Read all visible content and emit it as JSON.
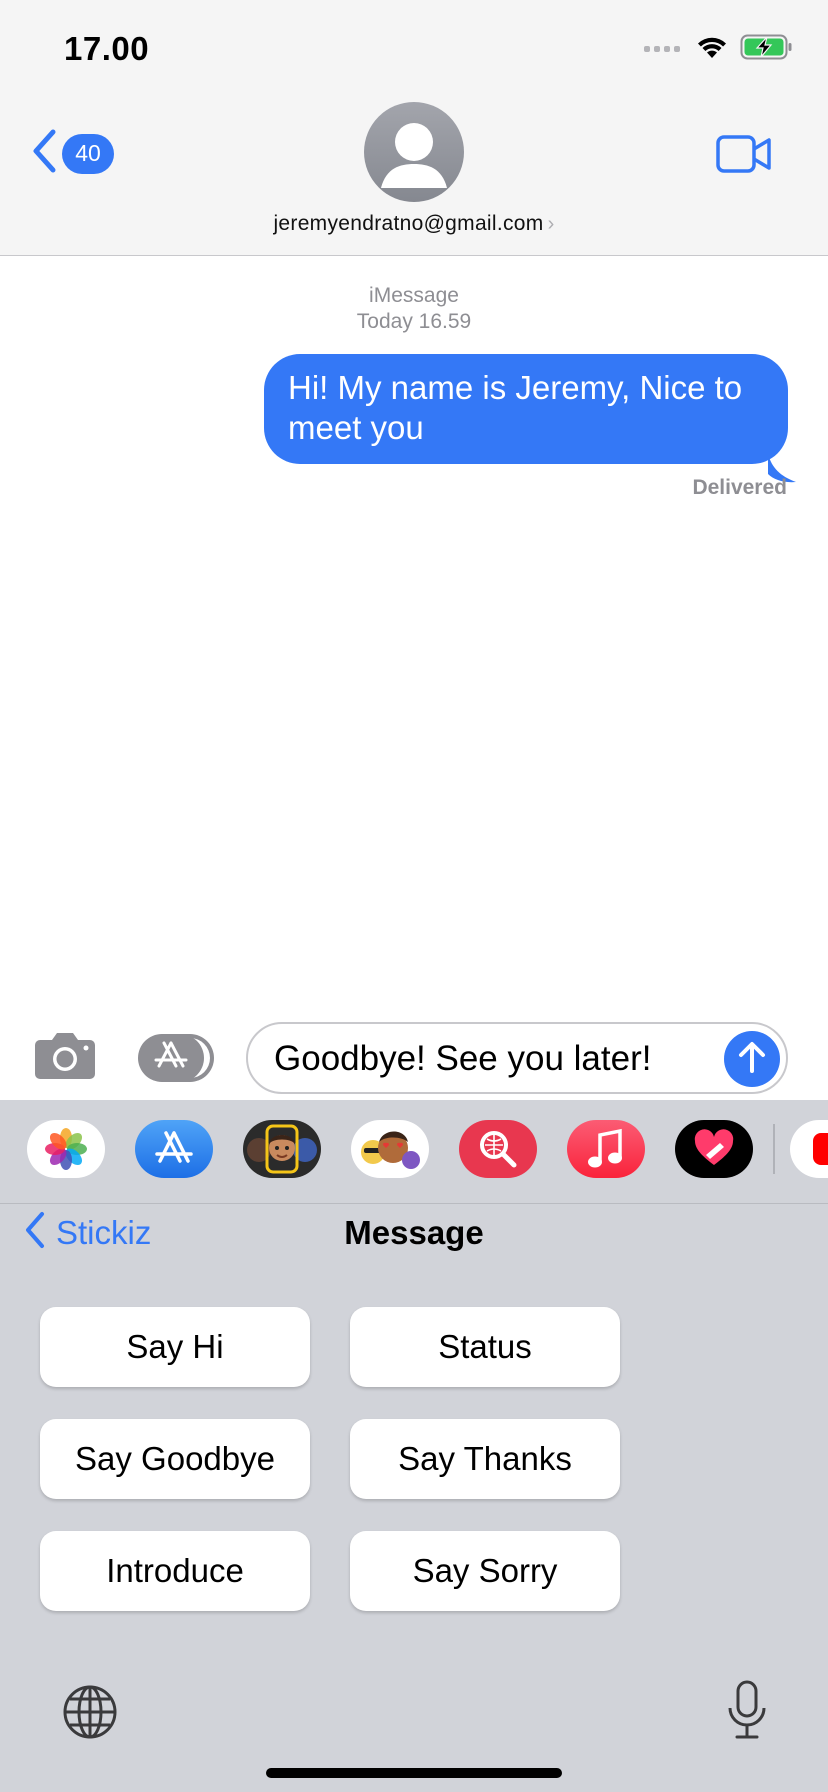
{
  "status_bar": {
    "time": "17.00",
    "icons": [
      "signal-icon",
      "wifi-icon",
      "battery-charging-icon"
    ]
  },
  "header": {
    "back_count": "40",
    "contact": "jeremyendratno@gmail.com",
    "contact_chevron": "›",
    "icons": [
      "chevron-left-icon",
      "avatar-icon",
      "video-camera-icon"
    ]
  },
  "conversation": {
    "service": "iMessage",
    "timestamp": "Today 16.59",
    "messages": [
      {
        "text": "Hi! My name is Jeremy, Nice to meet you",
        "sender": "me"
      }
    ],
    "delivered": "Delivered"
  },
  "composer": {
    "text": "Goodbye! See you later!",
    "icons": [
      "camera-icon",
      "app-store-icon",
      "send-arrow-icon"
    ]
  },
  "app_strip": {
    "apps": [
      "photos-icon",
      "app-store-icon",
      "memoji-camera-icon",
      "memoji-stickers-icon",
      "web-search-icon",
      "music-icon",
      "digital-touch-icon",
      "video-app-icon"
    ]
  },
  "extension": {
    "back_label": "Stickiz",
    "title": "Message",
    "buttons": [
      "Say Hi",
      "Status",
      "Say Goodbye",
      "Say Thanks",
      "Introduce",
      "Say Sorry"
    ]
  },
  "keyboard": {
    "icons": [
      "globe-icon",
      "microphone-icon"
    ]
  },
  "colors": {
    "accent": "#3478f6",
    "drawer_bg": "#d1d3d9",
    "header_bg": "#f5f5f5",
    "secondary_text": "#8e8e93"
  }
}
